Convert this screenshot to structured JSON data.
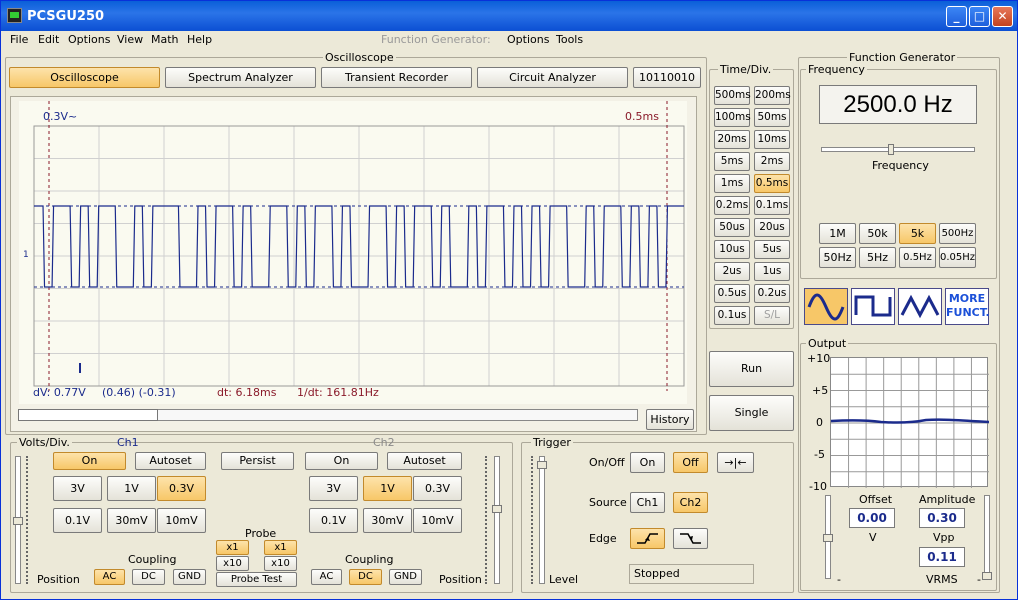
{
  "window": {
    "title": "PCSGU250",
    "min": "_",
    "max": "□",
    "close": "✕"
  },
  "menu": {
    "file": "File",
    "edit": "Edit",
    "options": "Options",
    "view": "View",
    "math": "Math",
    "help": "Help",
    "fg_label": "Function Generator:",
    "fg_options": "Options",
    "fg_tools": "Tools"
  },
  "oscilloscope": {
    "group_title": "Oscilloscope",
    "tabs": [
      "Oscilloscope",
      "Spectrum Analyzer",
      "Transient Recorder",
      "Circuit Analyzer",
      "10110010"
    ],
    "marker_v": "0.3V~",
    "marker_t": "0.5ms",
    "ch_marker": "1",
    "readout": {
      "dv": "dV: 0.77V",
      "dv_extra": "(0.46) (-0.31)",
      "dt": "dt: 6.18ms",
      "inv_dt": "1/dt: 161.81Hz"
    },
    "history": "History"
  },
  "timediv": {
    "title": "Time/Div.",
    "buttons": [
      "500ms",
      "200ms",
      "100ms",
      "50ms",
      "20ms",
      "10ms",
      "5ms",
      "2ms",
      "1ms",
      "0.5ms",
      "0.2ms",
      "0.1ms",
      "50us",
      "20us",
      "10us",
      "5us",
      "2us",
      "1us",
      "0.5us",
      "0.2us",
      "0.1us",
      "S/L"
    ],
    "selected": "0.5ms",
    "run": "Run",
    "single": "Single"
  },
  "volts": {
    "title": "Volts/Div.",
    "ch1": "Ch1",
    "ch2": "Ch2",
    "on": "On",
    "autoset": "Autoset",
    "persist": "Persist",
    "ch1_ranges": [
      "3V",
      "1V",
      "0.3V",
      "0.1V",
      "30mV",
      "10mV"
    ],
    "ch1_selected": "0.3V",
    "ch2_ranges": [
      "3V",
      "1V",
      "0.3V",
      "0.1V",
      "30mV",
      "10mV"
    ],
    "ch2_selected": "1V",
    "probe": "Probe",
    "x1": "x1",
    "x10": "x10",
    "probe_test": "Probe Test",
    "coupling": "Coupling",
    "ac": "AC",
    "dc": "DC",
    "gnd": "GND",
    "position": "Position"
  },
  "trigger": {
    "title": "Trigger",
    "onoff": "On/Off",
    "on": "On",
    "off": "Off",
    "arrows": "→|←",
    "source": "Source",
    "ch1": "Ch1",
    "ch2": "Ch2",
    "edge": "Edge",
    "level": "Level",
    "status": "Stopped"
  },
  "funcgen": {
    "title": "Function Generator",
    "freq_title": "Frequency",
    "freq_value": "2500.0 Hz",
    "freq_slider_label": "Frequency",
    "ranges": [
      "1M",
      "50k",
      "5k",
      "500Hz",
      "50Hz",
      "5Hz",
      "0.5Hz",
      "0.05Hz"
    ],
    "range_selected": "5k",
    "more": "MORE FUNCT.",
    "output_title": "Output",
    "out_ticks": [
      "+10",
      "+5",
      "0",
      "-5",
      "-10"
    ],
    "offset_label": "Offset",
    "offset_value": "0.00",
    "offset_unit": "V",
    "amp_label": "Amplitude",
    "amp_value": "0.30",
    "vpp": "Vpp",
    "vrms_value": "0.11",
    "vrms": "VRMS",
    "slider_min": "-",
    "slider_max": "-"
  },
  "colors": {
    "trace": "#1b2b8c",
    "cursor": "#8a1a2a",
    "selected": "#f7c768"
  }
}
